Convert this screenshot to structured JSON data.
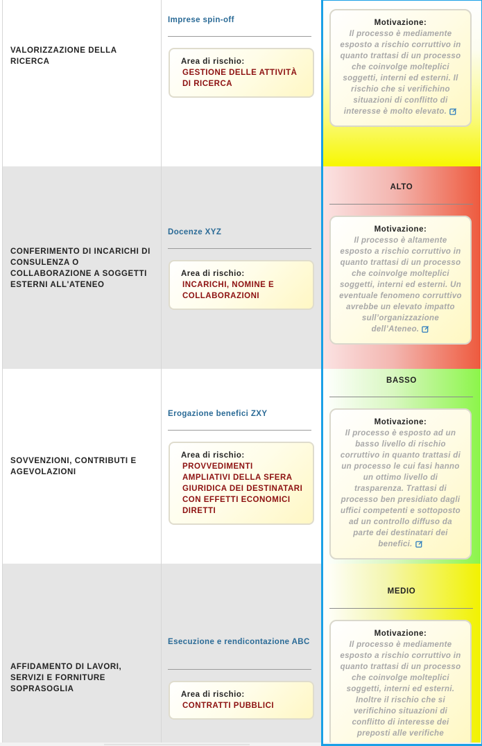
{
  "rows": [
    {
      "process": "VALORIZZAZIONE DELLA RICERCA",
      "subprocess": "Imprese spin-off",
      "area_label": "Area di rischio:",
      "area_value": "GESTIONE DELLE ATTIVITÀ DI RICERCA",
      "risk_level": "",
      "motivation_label": "Motivazione:",
      "motivation_text": "Il processo è mediamente esposto a rischio corruttivo in quanto trattasi di un processo che coinvolge molteplici soggetti, interni ed esterni. Il rischio che si verifichino situazioni di conflitto di interesse è molto elevato."
    },
    {
      "process": "CONFERIMENTO DI INCARICHI DI CONSULENZA O COLLABORAZIONE A SOGGETTI ESTERNI ALL'ATENEO",
      "subprocess": "Docenze XYZ",
      "area_label": "Area di rischio:",
      "area_value": "INCARICHI, NOMINE E COLLABORAZIONI",
      "risk_level": "ALTO",
      "motivation_label": "Motivazione:",
      "motivation_text": "Il processo è altamente esposto a rischio corruttivo in quanto trattasi di un processo che coinvolge molteplici soggetti, interni ed esterni. Un eventuale fenomeno corruttivo avrebbe un elevato impatto sull’organizzazione dell’Ateneo."
    },
    {
      "process": "SOVVENZIONI, CONTRIBUTI E AGEVOLAZIONI",
      "subprocess": "Erogazione benefici ZXY",
      "area_label": "Area di rischio:",
      "area_value": "PROVVEDIMENTI AMPLIATIVI DELLA SFERA GIURIDICA DEI DESTINATARI CON EFFETTI ECONOMICI DIRETTI",
      "risk_level": "BASSO",
      "motivation_label": "Motivazione:",
      "motivation_text": "Il processo è esposto ad un basso livello di rischio corruttivo in quanto trattasi di un processo le cui fasi hanno un ottimo livello di trasparenza. Trattasi di processo ben presidiato dagli uffici competenti e sottoposto ad un controllo diffuso da parte dei destinatari dei benefici."
    },
    {
      "process": "AFFIDAMENTO DI LAVORI, SERVIZI E FORNITURE SOPRASOGLIA",
      "subprocess": "Esecuzione e rendicontazione ABC",
      "area_label": "Area di rischio:",
      "area_value": "CONTRATTI PUBBLICI",
      "risk_level": "MEDIO",
      "motivation_label": "Motivazione:",
      "motivation_text": "Il processo è mediamente esposto a rischio corruttivo in quanto trattasi di un processo che coinvolge molteplici soggetti, interni ed esterni. Inoltre il rischio che si verifichino situazioni di conflitto di interesse dei preposti alle verifiche"
    }
  ],
  "colors": {
    "highlight_border": "#1aa0e6",
    "subprocess_text": "#2a6a96",
    "area_value_text": "#8c1010",
    "motivation_text": "#a8a8a8",
    "risk_alto": "#ee5a3e",
    "risk_basso": "#8cf54a",
    "risk_medio": "#f2f200"
  },
  "icons": {
    "edit": "edit-icon"
  }
}
